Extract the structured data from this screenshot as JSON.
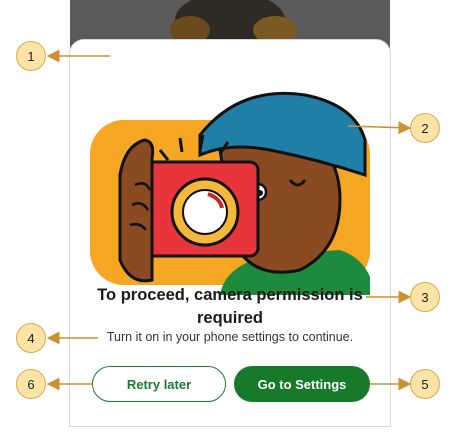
{
  "dialog": {
    "title": "To proceed, camera permission is required",
    "body": "Turn it on in your phone settings to continue.",
    "retry_label": "Retry later",
    "settings_label": "Go to Settings"
  },
  "callouts": [
    "1",
    "2",
    "3",
    "4",
    "5",
    "6"
  ],
  "colors": {
    "primary_green": "#177a28",
    "callout_fill": "#fbe4a6",
    "callout_arrow": "#c9922e",
    "illustration_orange": "#f5a623",
    "camera_red": "#e8353b",
    "cap_blue": "#1f7fa6"
  }
}
